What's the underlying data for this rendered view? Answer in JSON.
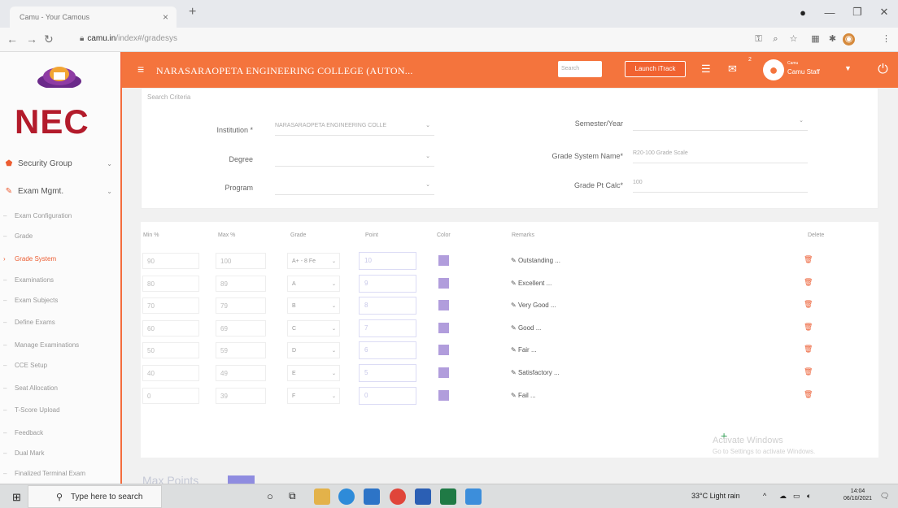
{
  "browser": {
    "tab_title": "Camu - Your Camous",
    "tab_close": "×",
    "new_tab": "+",
    "url_domain": "camu.in",
    "url_path": "/index#/gradesys"
  },
  "app": {
    "logo_text": "NEC",
    "college_name": "NARASARAOPETA ENGINEERING COLLEGE (AUTON...",
    "search_placeholder": "Search",
    "launch_button": "Launch iTrack",
    "mail_badge": "2",
    "user_role": "Camu",
    "user_name": "Camu Staff"
  },
  "sidebar": {
    "security_group": "Security Group",
    "exam_mgmt": "Exam Mgmt.",
    "sub_items": [
      "Exam Configuration",
      "Grade",
      "Grade System",
      "Examinations",
      "Exam Subjects",
      "Define Exams",
      "Manage Examinations",
      "CCE Setup",
      "Seat Allocation",
      "T-Score Upload",
      "Feedback",
      "Dual Mark",
      "Finalized Terminal Exam"
    ]
  },
  "criteria": {
    "title": "Search Criteria",
    "institution_label": "Institution *",
    "institution_value": "NARASARAOPETA ENGINEERING COLLE",
    "degree_label": "Degree",
    "program_label": "Program",
    "semester_label": "Semester/Year",
    "grade_system_label": "Grade System Name*",
    "grade_system_value": "R20-100 Grade Scale",
    "grade_pt_label": "Grade Pt Calc*",
    "grade_pt_value": "100"
  },
  "table": {
    "headers": {
      "min": "Min %",
      "max": "Max %",
      "grade": "Grade",
      "point": "Point",
      "color": "Color",
      "remarks": "Remarks",
      "delete": "Delete"
    },
    "rows": [
      {
        "min": "90",
        "max": "100",
        "grade": "A+ - 8 Fe",
        "point": "10",
        "remark": "Outstanding ..."
      },
      {
        "min": "80",
        "max": "89",
        "grade": "A",
        "point": "9",
        "remark": "Excellent ..."
      },
      {
        "min": "70",
        "max": "79",
        "grade": "B",
        "point": "8",
        "remark": "Very Good ..."
      },
      {
        "min": "60",
        "max": "69",
        "grade": "C",
        "point": "7",
        "remark": "Good ..."
      },
      {
        "min": "50",
        "max": "59",
        "grade": "D",
        "point": "6",
        "remark": "Fair ..."
      },
      {
        "min": "40",
        "max": "49",
        "grade": "E",
        "point": "5",
        "remark": "Satisfactory ..."
      },
      {
        "min": "0",
        "max": "39",
        "grade": "F",
        "point": "0",
        "remark": "Fail ..."
      }
    ],
    "swatch_color": "#b19ddc"
  },
  "watermark": {
    "line1": "Activate Windows",
    "line2": "Go to Settings to activate Windows."
  },
  "below_text": "Max Points",
  "taskbar": {
    "search_placeholder": "Type here to search",
    "weather": "33°C Light rain",
    "time": "14:04",
    "date": "06/10/2021"
  }
}
